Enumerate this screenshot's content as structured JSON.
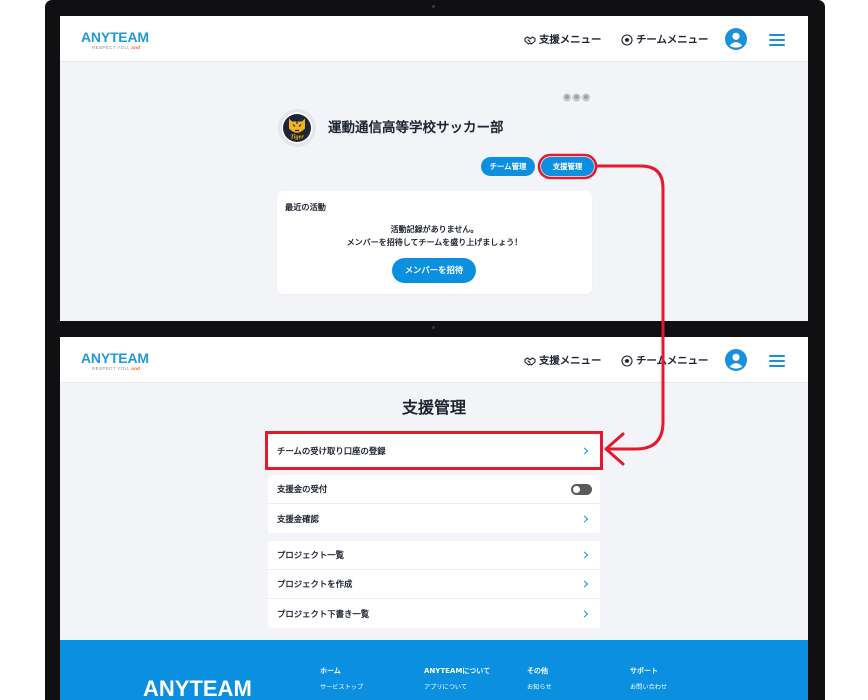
{
  "colors": {
    "brand_blue": "#1e9ad6",
    "primary_button": "#0b8fe0",
    "footer_background": "#0b8fe0",
    "page_background": "#f2f4f7",
    "highlight_red": "#e6172f",
    "toggle_off": "#5b5b5b",
    "tagline_accent": "#f25a24"
  },
  "header": {
    "logo": "ANYTEAM",
    "tagline": "RESPECT YOU,",
    "tagline_accent": "and",
    "support_menu": {
      "label": "支援メニュー",
      "icon": "handshake-icon"
    },
    "team_menu": {
      "label": "チームメニュー",
      "icon": "soccer-ball-icon"
    },
    "user_icon": "user-avatar-icon",
    "menu_icon": "hamburger-menu-icon"
  },
  "team_page": {
    "team_name": "運動通信高等学校サッカー部",
    "team_logo_text": "Tiger",
    "buttons": {
      "team_manage": "チーム管理",
      "support_manage": "支援管理"
    },
    "activity": {
      "title": "最近の活動",
      "empty_message": "活動記録がありません。",
      "invite_prompt": "メンバーを招待してチームを盛り上げましょう！",
      "invite_button": "メンバーを招待"
    }
  },
  "support_page": {
    "title": "支援管理",
    "groups": [
      {
        "items": [
          {
            "label": "チームの受け取り口座の登録",
            "icon": "chevron-right-icon"
          }
        ]
      },
      {
        "items": [
          {
            "label": "支援金の受付",
            "toggle_on": false
          },
          {
            "label": "支援金確認",
            "icon": "chevron-right-icon"
          }
        ]
      },
      {
        "items": [
          {
            "label": "プロジェクト一覧",
            "icon": "chevron-right-icon"
          },
          {
            "label": "プロジェクトを作成",
            "icon": "chevron-right-icon"
          },
          {
            "label": "プロジェクト下書き一覧",
            "icon": "chevron-right-icon"
          }
        ]
      }
    ]
  },
  "footer": {
    "logo": "ANYTEAM",
    "columns": [
      {
        "heading": "ホーム",
        "links": [
          "サービストップ"
        ]
      },
      {
        "heading": "ANYTEAMについて",
        "links": [
          "アプリについて"
        ]
      },
      {
        "heading": "その他",
        "links": [
          "お知らせ"
        ]
      },
      {
        "heading": "サポート",
        "links": [
          "お問い合わせ"
        ]
      }
    ]
  }
}
